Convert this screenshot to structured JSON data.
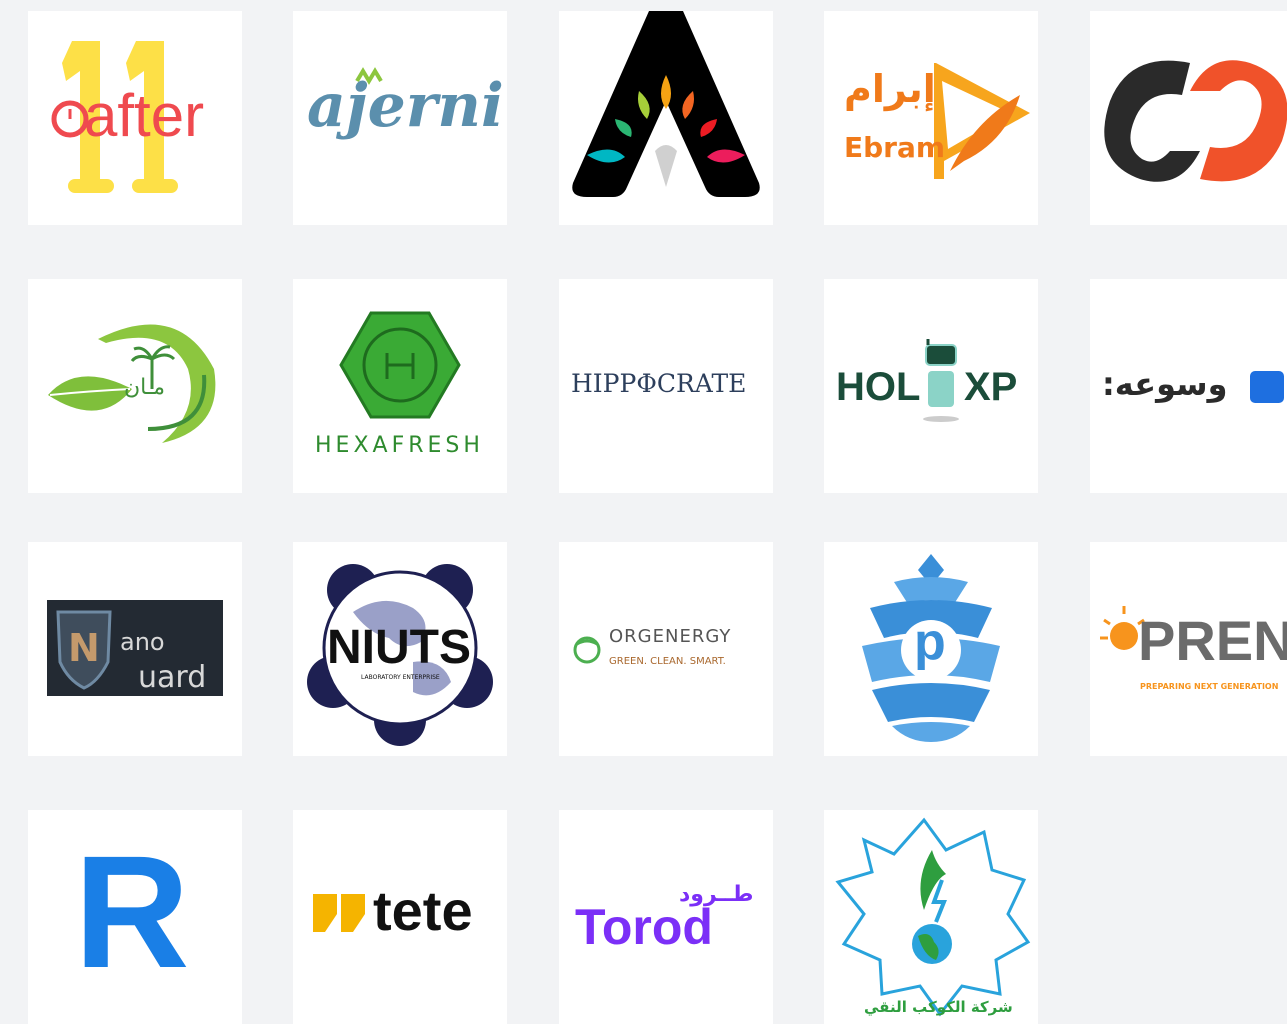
{
  "logos": [
    {
      "name": "11after",
      "text": "after",
      "digits": "11"
    },
    {
      "name": "ajerni",
      "text": "ajerni"
    },
    {
      "name": "a-drops"
    },
    {
      "name": "ebram",
      "arabic": "إبرام",
      "text": "Ebram"
    },
    {
      "name": "co-swirl"
    },
    {
      "name": "leaf-palm",
      "arabic": "مـان"
    },
    {
      "name": "hexafresh",
      "text": "HEXAFRESH"
    },
    {
      "name": "hippocrate",
      "text": "HIPPΦCRATE"
    },
    {
      "name": "holixp",
      "text_left": "HOL",
      "text_right": "XP"
    },
    {
      "name": "wasea",
      "arabic": ":وسوعه"
    },
    {
      "name": "nanoguard",
      "n": "N",
      "ano": "ano",
      "uard": "uard"
    },
    {
      "name": "niuts",
      "text": "NIUTS",
      "sub": "LABORATORY ENTERPRISE"
    },
    {
      "name": "orgenergy",
      "text": "ORGENERGY",
      "sub": "GREEN. CLEAN. SMART."
    },
    {
      "name": "pinecone",
      "text": "p"
    },
    {
      "name": "preng",
      "text": "PRENG",
      "sub": "PREPARING NEXT GENERATION"
    },
    {
      "name": "r-logo",
      "text": "R"
    },
    {
      "name": "tete",
      "text": "tete"
    },
    {
      "name": "torod",
      "text": "Torod",
      "arabic": "طــرود"
    },
    {
      "name": "kawkab",
      "arabic": "شركة الكوكب النقي"
    }
  ],
  "colors": {
    "background": "#f2f3f5",
    "card": "#ffffff",
    "after_red": "#ef4a4f",
    "after_yellow": "#fde047",
    "ajerni_blue": "#5b8fad",
    "ebram_orange": "#f07a1a",
    "hexafresh_green": "#3aaa35",
    "holixp_green": "#1b4d3a",
    "wasea_blue": "#1e6fe0",
    "niuts_navy": "#1e2052",
    "pine_blue": "#3a8fd8",
    "preng_gray": "#6b6b6b",
    "r_blue": "#1a7fe6",
    "torod_purple": "#7b2ff7",
    "kawkab_green": "#2e9e3f"
  }
}
